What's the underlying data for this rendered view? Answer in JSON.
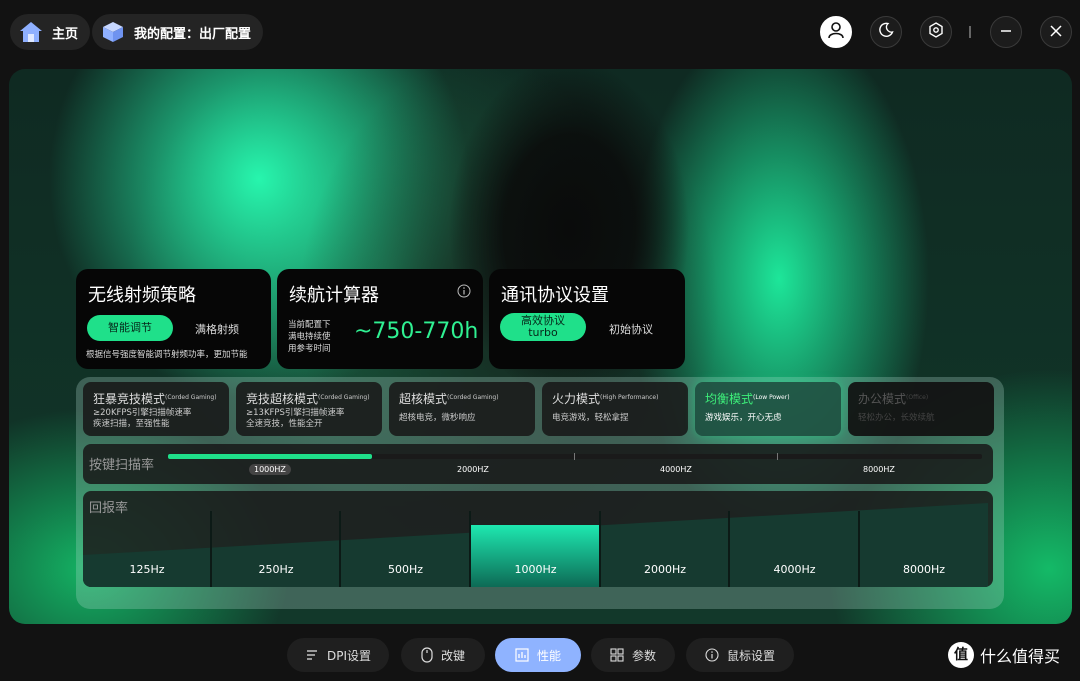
{
  "topbar": {
    "home_label": "主页",
    "config_label": "我的配置：出厂配置",
    "icons": [
      "home-icon",
      "cube-icon",
      "user-icon",
      "moon-icon",
      "settings-hex-icon",
      "minimize-icon",
      "close-icon"
    ]
  },
  "cards": {
    "rf": {
      "title": "无线射频策略",
      "option_active": "智能调节",
      "option_other": "满格射频",
      "desc": "根据信号强度智能调节射频功率，更加节能"
    },
    "battery": {
      "title": "续航计算器",
      "desc_line1": "当前配置下",
      "desc_line2": "满电持续使",
      "desc_line3": "用参考时间",
      "value": "~750-770h"
    },
    "protocol": {
      "title": "通讯协议设置",
      "option_active_line1": "高效协议",
      "option_active_line2": "turbo",
      "option_other": "初始协议"
    }
  },
  "modes": [
    {
      "name": "狂暴竞技模式",
      "tag": "(Corded Gaming)",
      "desc1": "≥20KFPS引擎扫描帧速率",
      "desc2": "疾速扫描，至强性能"
    },
    {
      "name": "竞技超核模式",
      "tag": "(Corded Gaming)",
      "desc1": "≥13KFPS引擎扫描帧速率",
      "desc2": "全速竞技，性能全开"
    },
    {
      "name": "超核模式",
      "tag": "(Corded Gaming)",
      "desc1": "超核电竞，微秒响应",
      "desc2": ""
    },
    {
      "name": "火力模式",
      "tag": "(High Performance)",
      "desc1": "电竞游戏，轻松拿捏",
      "desc2": ""
    },
    {
      "name": "均衡模式",
      "tag": "(Low Power)",
      "desc1": "游戏娱乐，开心无虑",
      "desc2": ""
    },
    {
      "name": "办公模式",
      "tag": "(Office)",
      "desc1": "轻松办公，长效续航",
      "desc2": ""
    }
  ],
  "selected_mode_index": 4,
  "scan": {
    "label": "按键扫描率",
    "ticks": [
      "1000HZ",
      "2000HZ",
      "4000HZ",
      "8000HZ"
    ],
    "selected": "1000HZ",
    "fill_fraction": 0.25
  },
  "report": {
    "label": "回报率",
    "rates": [
      "125Hz",
      "250Hz",
      "500Hz",
      "1000Hz",
      "2000Hz",
      "4000Hz",
      "8000Hz"
    ],
    "selected": "1000Hz"
  },
  "tabs": [
    {
      "label": "DPI设置",
      "icon": "dpi-icon"
    },
    {
      "label": "改键",
      "icon": "mouse-icon"
    },
    {
      "label": "性能",
      "icon": "chart-icon"
    },
    {
      "label": "参数",
      "icon": "grid-icon"
    },
    {
      "label": "鼠标设置",
      "icon": "info-icon"
    }
  ],
  "active_tab": "性能",
  "watermark": "值 什么值得买",
  "colors": {
    "accent_green": "#1fe08a",
    "active_tab": "#8fb3ff",
    "mode_selected_text": "#3df07a"
  }
}
